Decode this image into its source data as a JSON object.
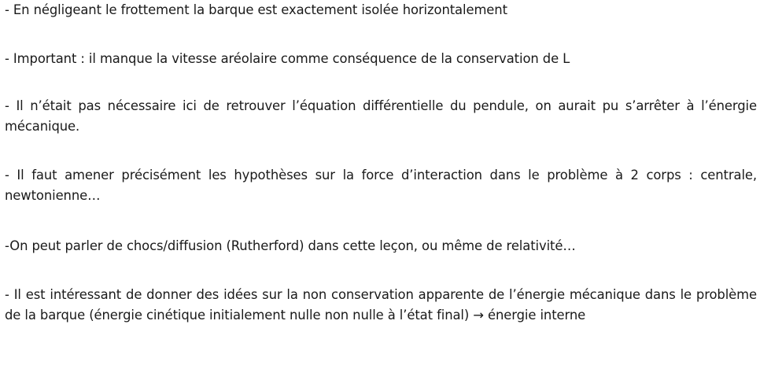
{
  "document": {
    "paragraphs": [
      "- En négligeant le frottement la barque est exactement isolée horizontalement",
      "- Important : il manque la vitesse aréolaire comme conséquence de la conservation de L",
      "- Il n’était pas nécessaire ici de retrouver l’équation différentielle du pendule, on aurait pu s’arrêter à l’énergie mécanique.",
      "- Il faut amener précisément les hypothèses sur la force d’interaction dans le problème à 2 corps : centrale, newtonienne…",
      "-On peut parler de chocs/diffusion (Rutherford) dans cette leçon, ou même de relativité…",
      "- Il est intéressant de donner des idées sur la non conservation apparente de l’énergie mécanique dans le problème de la barque (énergie cinétique initialement nulle non nulle à l’état final) → énergie interne"
    ]
  }
}
